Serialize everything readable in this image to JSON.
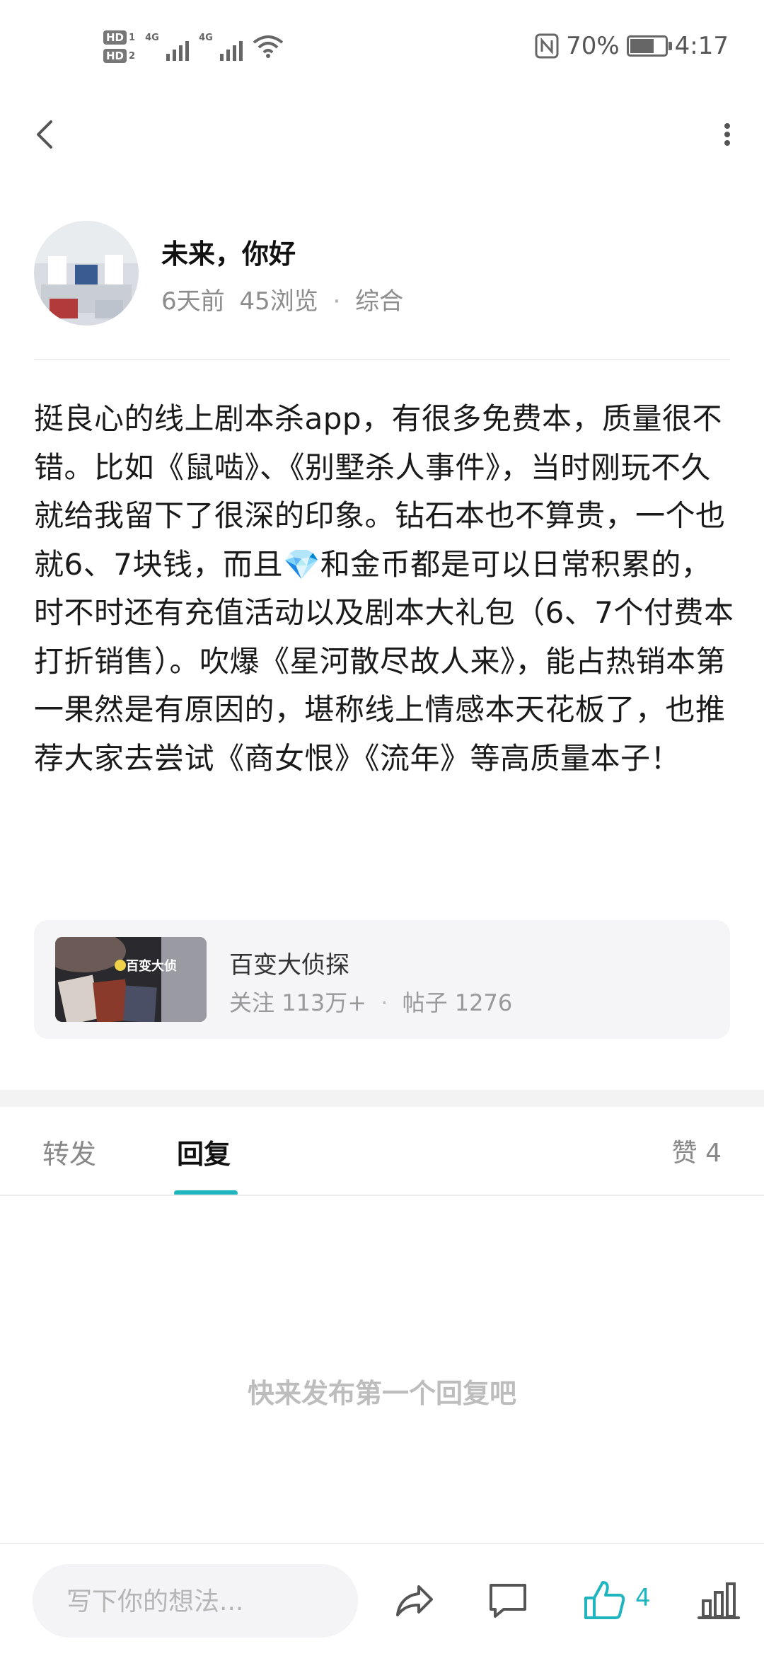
{
  "status_bar": {
    "hd1": "HD",
    "hd1_sim": "1",
    "hd2": "HD",
    "hd2_sim": "2",
    "net1": "4G",
    "net2": "4G",
    "battery_percent": "70%",
    "time": "4:17"
  },
  "post": {
    "author_name": "未来，你好",
    "time_ago": "6天前",
    "views": "45浏览",
    "category": "综合",
    "body": "挺良心的线上剧本杀app，有很多免费本，质量很不错。比如《鼠啮》、《别墅杀人事件》，当时刚玩不久就给我留下了很深的印象。钻石本也不算贵，一个也就6、7块钱，而且💎和金币都是可以日常积累的，时不时还有充值活动以及剧本大礼包（6、7个付费本打折销售）。吹爆《星河散尽故人来》，能占热销本第一果然是有原因的，堪称线上情感本天花板了，也推荐大家去尝试《商女恨》《流年》等高质量本子！"
  },
  "forum_card": {
    "name": "百变大侦探",
    "followers": "关注 113万+",
    "posts": "帖子 1276",
    "thumb_text": "百变大侦"
  },
  "tabs": {
    "forward": "转发",
    "reply": "回复",
    "like": "赞 4"
  },
  "empty_text": "快来发布第一个回复吧",
  "bottom_bar": {
    "input_placeholder": "写下你的想法...",
    "like_count": "4"
  },
  "colors": {
    "accent": "#1fb5bf",
    "muted": "#8c8c8c",
    "card_bg": "#f5f5f7"
  },
  "icons": [
    "back-arrow-icon",
    "more-vertical-icon",
    "share-icon",
    "comment-icon",
    "thumbs-up-icon",
    "stats-icon",
    "nfc-icon",
    "battery-icon",
    "wifi-icon",
    "signal-icon"
  ]
}
